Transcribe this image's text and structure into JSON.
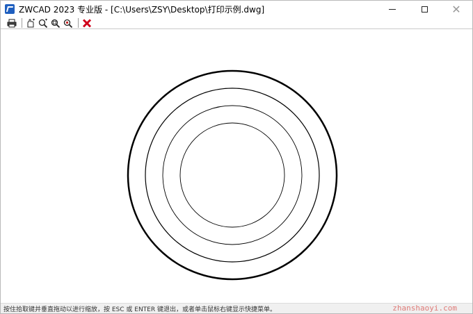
{
  "window": {
    "title": "ZWCAD 2023 专业版 - [C:\\Users\\ZSY\\Desktop\\打印示例.dwg]"
  },
  "toolbar": {
    "buttons": [
      {
        "icon": "printer-icon"
      },
      {
        "icon": "pan-icon"
      },
      {
        "icon": "zoom-realtime-icon"
      },
      {
        "icon": "zoom-window-icon"
      },
      {
        "icon": "zoom-extents-icon"
      },
      {
        "icon": "close-preview-icon"
      }
    ]
  },
  "drawing": {
    "stroke_color": "#000000",
    "background": "#ffffff"
  },
  "status": {
    "text": "按住拾取键并垂直拖动以进行缩放，按 ESC 或 ENTER 键退出，或者单击鼠标右键显示快捷菜单。"
  },
  "watermark": {
    "text": "zhanshaoyi.com"
  },
  "colors": {
    "close_x": "#d0021b",
    "app_icon": "#1f5fbf"
  }
}
